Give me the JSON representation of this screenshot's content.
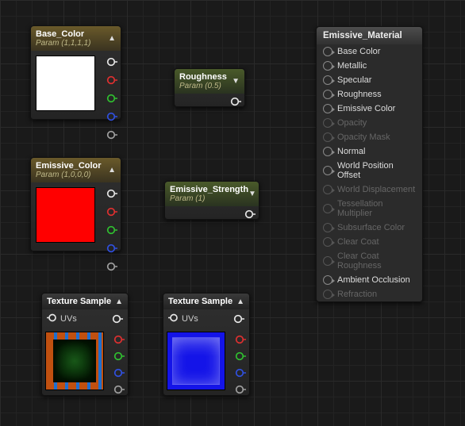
{
  "nodes": {
    "base_color": {
      "title": "Base_Color",
      "subtitle": "Param (1,1,1,1)",
      "swatch": "#ffffff"
    },
    "emissive_color": {
      "title": "Emissive_Color",
      "subtitle": "Param (1,0,0,0)",
      "swatch": "#ff0000"
    },
    "roughness": {
      "title": "Roughness",
      "subtitle": "Param (0.5)"
    },
    "emissive_strength": {
      "title": "Emissive_Strength",
      "subtitle": "Param (1)"
    },
    "tex_sample_a": {
      "title": "Texture Sample",
      "uvs_label": "UVs"
    },
    "tex_sample_b": {
      "title": "Texture Sample",
      "uvs_label": "UVs"
    }
  },
  "pin_colors": {
    "white": "#e6e6e6",
    "red": "#e03030",
    "green": "#30c030",
    "blue": "#3050e0",
    "grey": "#a0a0a0"
  },
  "result": {
    "title": "Emissive_Material",
    "rows": [
      {
        "label": "Base Color",
        "enabled": true
      },
      {
        "label": "Metallic",
        "enabled": true
      },
      {
        "label": "Specular",
        "enabled": true
      },
      {
        "label": "Roughness",
        "enabled": true
      },
      {
        "label": "Emissive Color",
        "enabled": true
      },
      {
        "label": "Opacity",
        "enabled": false
      },
      {
        "label": "Opacity Mask",
        "enabled": false
      },
      {
        "label": "Normal",
        "enabled": true
      },
      {
        "label": "World Position Offset",
        "enabled": true
      },
      {
        "label": "World Displacement",
        "enabled": false
      },
      {
        "label": "Tessellation Multiplier",
        "enabled": false
      },
      {
        "label": "Subsurface Color",
        "enabled": false
      },
      {
        "label": "Clear Coat",
        "enabled": false
      },
      {
        "label": "Clear Coat Roughness",
        "enabled": false
      },
      {
        "label": "Ambient Occlusion",
        "enabled": true
      },
      {
        "label": "Refraction",
        "enabled": false
      }
    ]
  }
}
